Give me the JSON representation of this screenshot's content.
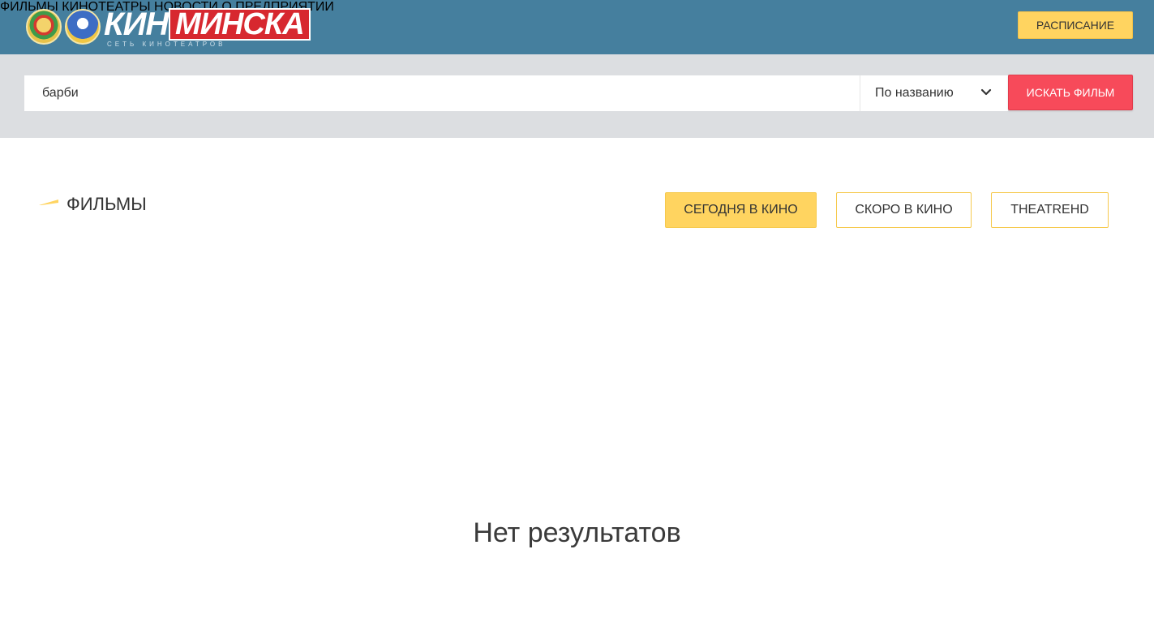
{
  "header": {
    "logo": {
      "word1": "КИНО",
      "word2": "МИНСКА",
      "subtitle": "СЕТЬ КИНОТЕАТРОВ"
    },
    "nav": [
      "ФИЛЬМЫ",
      "КИНОТЕАТРЫ",
      "НОВОСТИ",
      "О ПРЕДПРИЯТИИ"
    ],
    "schedule_label": "РАСПИСАНИЕ"
  },
  "search": {
    "value": "барби",
    "select_value": "По названию",
    "button_label": "ИСКАТЬ ФИЛЬМ"
  },
  "section": {
    "title": "ФИЛЬМЫ",
    "tabs": [
      "СЕГОДНЯ В КИНО",
      "СКОРО В КИНО",
      "THEATREHD"
    ]
  },
  "results": {
    "empty_text": "Нет результатов"
  },
  "colors": {
    "header_bg": "#457f9e",
    "accent_yellow": "#ffd460",
    "search_red": "#f74a5a"
  }
}
